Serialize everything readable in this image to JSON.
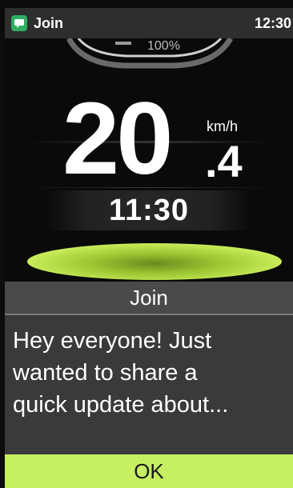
{
  "status_bar": {
    "app_name": "Join",
    "time": "12:30",
    "app_icon": "message-icon"
  },
  "dashboard": {
    "gauge_text": "100%",
    "speed_integer": "20",
    "speed_decimal": ".4",
    "speed_unit": "km/h",
    "clock": "11:30",
    "accent_color": "#c6f062"
  },
  "dialog": {
    "title": "Join",
    "message_lines": [
      "Hey everyone! Just",
      "wanted to share a",
      "quick update about..."
    ],
    "ok_label": "OK"
  }
}
